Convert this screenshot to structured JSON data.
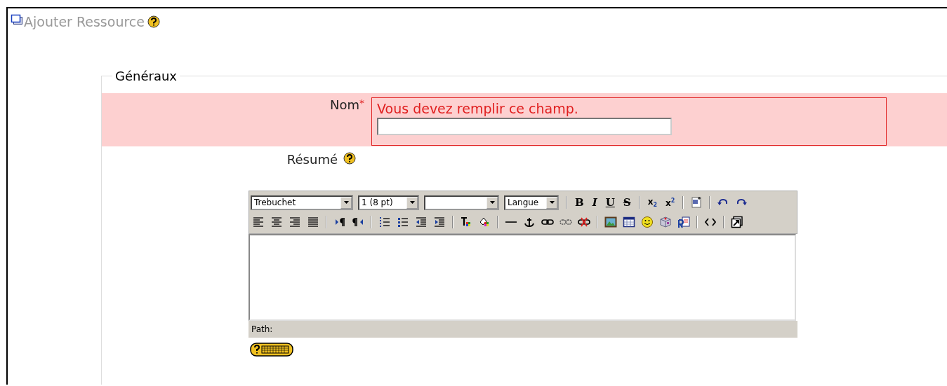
{
  "page": {
    "title": "Ajouter Ressource"
  },
  "form": {
    "legend": "Généraux",
    "fields": [
      {
        "kind": "text",
        "label": "Nom",
        "required_mark": "*",
        "error": "Vous devez remplir ce champ."
      },
      {
        "kind": "editor",
        "label": "Résumé",
        "help": true
      }
    ]
  },
  "editor": {
    "toolbar_rows": [
      [
        {
          "kind": "select",
          "value": "Trebuchet"
        },
        {
          "kind": "select",
          "value": "1 (8 pt)"
        },
        {
          "kind": "select"
        },
        {
          "kind": "select",
          "value": "Langue"
        },
        {
          "kind": "sep"
        },
        {
          "kind": "bold",
          "label": "B"
        },
        {
          "kind": "italic",
          "label": "I"
        },
        {
          "kind": "underline",
          "label": "U"
        },
        {
          "kind": "strike",
          "label": "S"
        },
        {
          "kind": "sep"
        },
        {
          "kind": "subscript",
          "label": "x$_{2}$"
        },
        {
          "kind": "superscript",
          "label": "x$^{2}$"
        },
        {
          "kind": "sep"
        },
        {
          "kind": "word"
        },
        {
          "kind": "sep"
        },
        {
          "kind": "undo"
        },
        {
          "kind": "redo"
        }
      ],
      [
        {
          "kind": "align-left"
        },
        {
          "kind": "align-center"
        },
        {
          "kind": "align-right"
        },
        {
          "kind": "justify"
        },
        {
          "kind": "sep"
        },
        {
          "kind": "ltr"
        },
        {
          "kind": "rtl"
        },
        {
          "kind": "sep"
        },
        {
          "kind": "ordered-list"
        },
        {
          "kind": "bullet-list"
        },
        {
          "kind": "outdent"
        },
        {
          "kind": "indent"
        },
        {
          "kind": "sep"
        },
        {
          "kind": "text-color"
        },
        {
          "kind": "fill-color"
        },
        {
          "kind": "sep"
        },
        {
          "kind": "rule"
        },
        {
          "kind": "anchor"
        },
        {
          "kind": "link"
        },
        {
          "kind": "unlink"
        },
        {
          "kind": "nolink"
        },
        {
          "kind": "sep"
        },
        {
          "kind": "image"
        },
        {
          "kind": "table"
        },
        {
          "kind": "smiley"
        },
        {
          "kind": "cube"
        },
        {
          "kind": "paste"
        },
        {
          "kind": "sep"
        },
        {
          "kind": "source"
        },
        {
          "kind": "sep"
        },
        {
          "kind": "fullscreen"
        }
      ]
    ],
    "path_label": "Path:"
  }
}
